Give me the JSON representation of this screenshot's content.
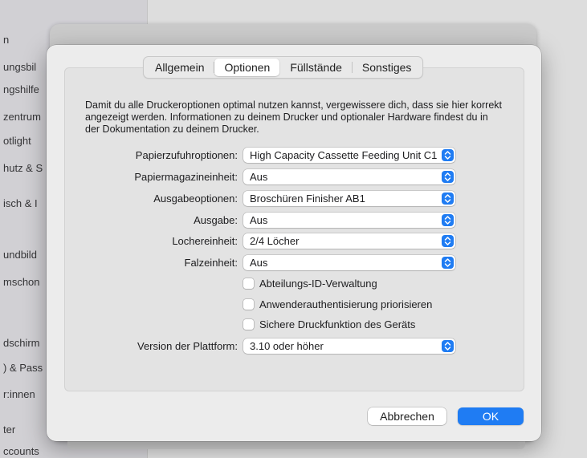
{
  "background": {
    "sidebar_items": [
      "n",
      "ungsbil",
      "ngshilfe",
      "zentrum",
      "otlight",
      "hutz & S",
      "isch & I",
      "undbild",
      "mschon",
      "dschirm",
      ") & Pass",
      "r:innen",
      "ter",
      "ccounts"
    ]
  },
  "dialog": {
    "tabs": [
      {
        "label": "Allgemein",
        "active": false
      },
      {
        "label": "Optionen",
        "active": true
      },
      {
        "label": "Füllstände",
        "active": false
      },
      {
        "label": "Sonstiges",
        "active": false
      }
    ],
    "description": "Damit du alle Druckeroptionen optimal nutzen kannst, vergewissere dich, dass sie hier korrekt angezeigt werden. Informationen zu deinem Drucker und optionaler Hardware findest du in der Dokumentation zu deinem Drucker.",
    "options": [
      {
        "label": "Papierzufuhroptionen:",
        "value": "High Capacity Cassette Feeding Unit C1"
      },
      {
        "label": "Papiermagazineinheit:",
        "value": "Aus"
      },
      {
        "label": "Ausgabeoptionen:",
        "value": "Broschüren Finisher AB1"
      },
      {
        "label": "Ausgabe:",
        "value": "Aus"
      },
      {
        "label": "Lochereinheit:",
        "value": "2/4 Löcher"
      },
      {
        "label": "Falzeinheit:",
        "value": "Aus"
      }
    ],
    "checkboxes": [
      {
        "label": "Abteilungs-ID-Verwaltung",
        "checked": false
      },
      {
        "label": "Anwenderauthentisierung priorisieren",
        "checked": false
      },
      {
        "label": "Sichere Druckfunktion des Geräts",
        "checked": false
      }
    ],
    "platform": {
      "label": "Version der Plattform:",
      "value": "3.10 oder höher"
    },
    "cancel_label": "Abbrechen",
    "ok_label": "OK"
  },
  "colors": {
    "accent": "#1f7cf3"
  }
}
